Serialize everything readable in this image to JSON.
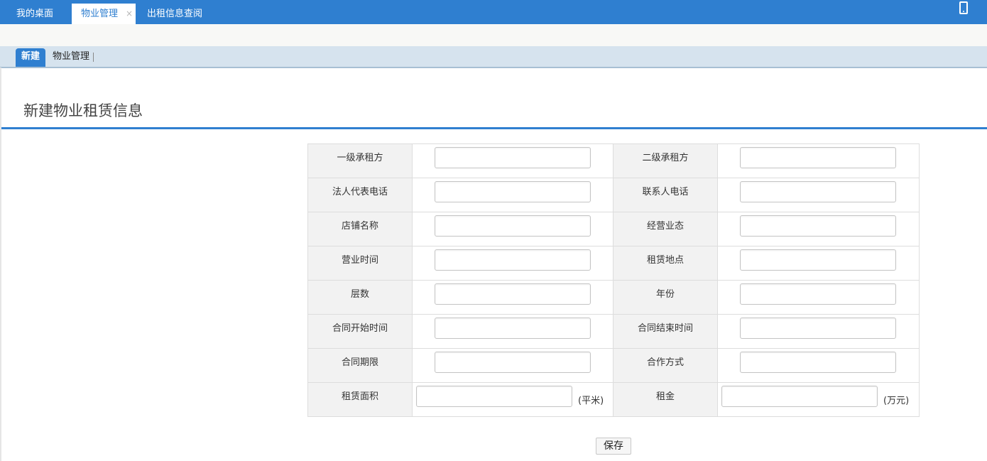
{
  "top_tabs": [
    {
      "label": "我的桌面"
    },
    {
      "label": "物业管理",
      "close": "×"
    },
    {
      "label": "出租信息查阅"
    }
  ],
  "sub_tabs": {
    "new_label": "新建",
    "property_label": "物业管理"
  },
  "page": {
    "title": "新建物业租赁信息"
  },
  "form": {
    "rows": [
      {
        "left_label": "一级承租方",
        "left_value": "",
        "right_label": "二级承租方",
        "right_value": ""
      },
      {
        "left_label": "法人代表电话",
        "left_value": "",
        "right_label": "联系人电话",
        "right_value": ""
      },
      {
        "left_label": "店铺名称",
        "left_value": "",
        "right_label": "经营业态",
        "right_value": ""
      },
      {
        "left_label": "营业时间",
        "left_value": "",
        "right_label": "租赁地点",
        "right_value": ""
      },
      {
        "left_label": "层数",
        "left_value": "",
        "right_label": "年份",
        "right_value": ""
      },
      {
        "left_label": "合同开始时间",
        "left_value": "",
        "right_label": "合同结束时间",
        "right_value": ""
      },
      {
        "left_label": "合同期限",
        "left_value": "",
        "right_label": "合作方式",
        "right_value": ""
      },
      {
        "left_label": "租赁面积",
        "left_value": "",
        "left_unit": "(平米)",
        "right_label": "租金",
        "right_value": "",
        "right_unit": "(万元)"
      }
    ],
    "save_label": "保存"
  },
  "colors": {
    "accent": "#2f7fd0",
    "subbar": "#d6e3ee",
    "label_bg": "#f2f2f2"
  }
}
